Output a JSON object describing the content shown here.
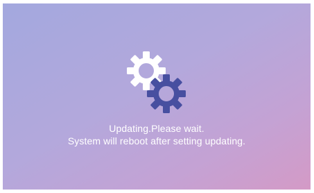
{
  "screen": {
    "status_line": "Updating.Please wait.",
    "detail_line": "System will reboot after setting updating."
  },
  "icons": {
    "large_gear": "gear-icon",
    "small_gear": "gear-icon"
  },
  "colors": {
    "background_top_left": "#a3a8de",
    "background_bottom_right": "#d49ac6",
    "text": "#ffffff",
    "gear_light": "#ffffff",
    "gear_dark": "#474fa0"
  }
}
